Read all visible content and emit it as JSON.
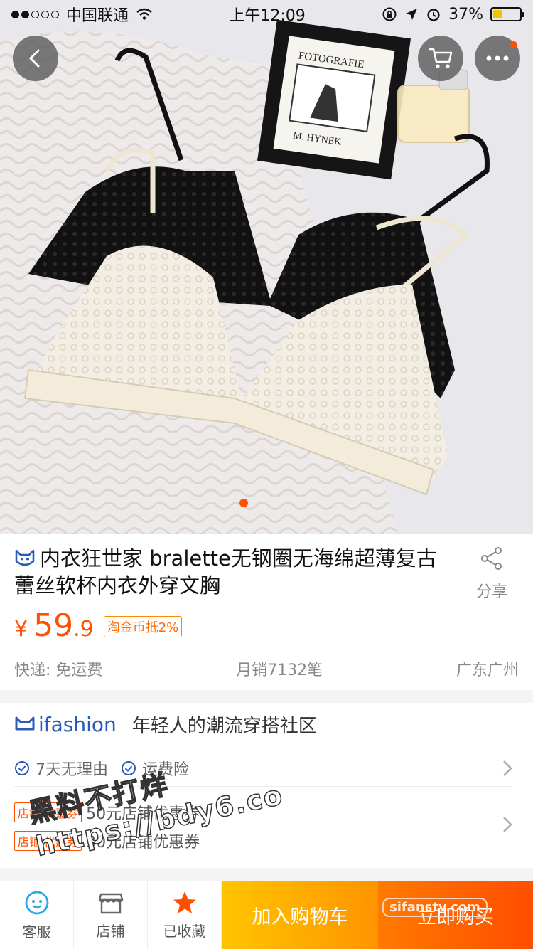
{
  "status_bar": {
    "carrier": "中国联通",
    "time": "上午12:09",
    "battery_percent": "37%",
    "battery_level": 0.37
  },
  "product": {
    "brand_icon": "tmall-cat-icon",
    "title": "内衣狂世家 bralette无钢圈无海绵超薄复古蕾丝软杯内衣外穿文胸",
    "share_label": "分享",
    "currency": "¥",
    "price_int": "59",
    "price_dec": ".9",
    "coin_badge": "淘金币抵2%",
    "shipping": "快递: 免运费",
    "monthly_sales": "月销7132笔",
    "location": "广东广州"
  },
  "ifashion": {
    "logo_text": "ifashion",
    "slogan": "年轻人的潮流穿搭社区",
    "services": [
      "7天无理由",
      "运费险"
    ],
    "coupon_tag": "店铺 优惠券",
    "coupons": [
      "50元店铺优惠券",
      "30元店铺优惠券"
    ]
  },
  "watermark": {
    "line1": "黑料不打烊",
    "line2": "https://bdy6.co",
    "tag": "sifanstv.com"
  },
  "bottom_bar": {
    "service": "客服",
    "shop": "店铺",
    "favorited": "已收藏",
    "add_to_cart": "加入购物车",
    "buy_now": "立即购买"
  },
  "colors": {
    "accent": "#ff5000",
    "cart_gradient": [
      "#ffc500",
      "#ff9400"
    ],
    "buy_gradient": [
      "#ff7a00",
      "#ff4e00"
    ],
    "ifashion_blue": "#2b5bb8"
  }
}
